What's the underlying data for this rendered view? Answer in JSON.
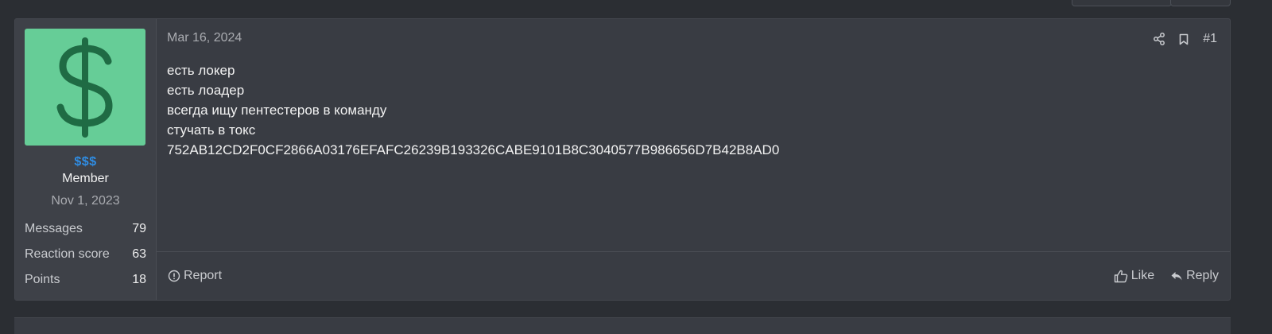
{
  "post": {
    "date": "Mar 16, 2024",
    "number": "#1",
    "body_lines": [
      "есть локер",
      "есть лоадер",
      "всегда ищу пентестеров в команду",
      "стучать в токс",
      "752AB12CD2F0CF2866A03176EFAFC26239B193326CABE9101B8C3040577B986656D7B42B8AD0"
    ]
  },
  "user": {
    "name": "$$$",
    "title": "Member",
    "join_date": "Nov 1, 2023",
    "stats": [
      {
        "label": "Messages",
        "value": "79"
      },
      {
        "label": "Reaction score",
        "value": "63"
      },
      {
        "label": "Points",
        "value": "18"
      }
    ],
    "avatar_icon": "dollar-sign-icon",
    "avatar_bg": "#66cd97",
    "avatar_fg": "#1f6b44"
  },
  "footer": {
    "report_label": "Report",
    "like_label": "Like",
    "reply_label": "Reply"
  },
  "colors": {
    "username": "#2f8de4",
    "panel": "#393c43"
  }
}
